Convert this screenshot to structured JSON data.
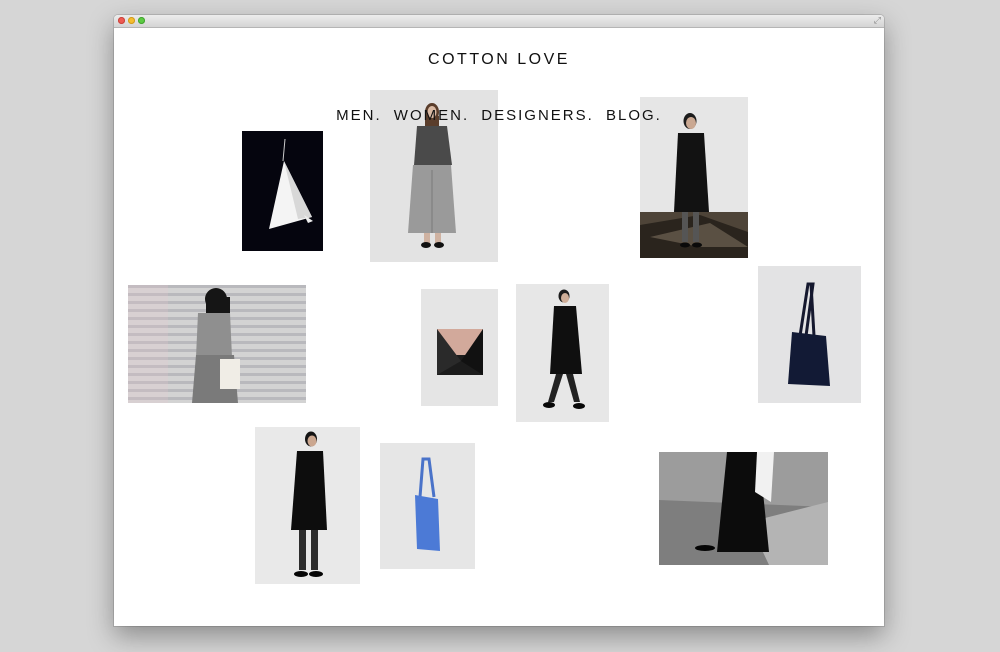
{
  "site": {
    "title": "COTTON LOVE"
  },
  "nav": [
    {
      "label": "MEN."
    },
    {
      "label": "WOMEN."
    },
    {
      "label": "DESIGNERS."
    },
    {
      "label": "BLOG."
    }
  ],
  "window": {
    "controls": [
      "close",
      "minimize",
      "zoom"
    ]
  },
  "colors": {
    "background": "#ffffff",
    "text": "#111111",
    "chrome": "#d6d6d6"
  }
}
